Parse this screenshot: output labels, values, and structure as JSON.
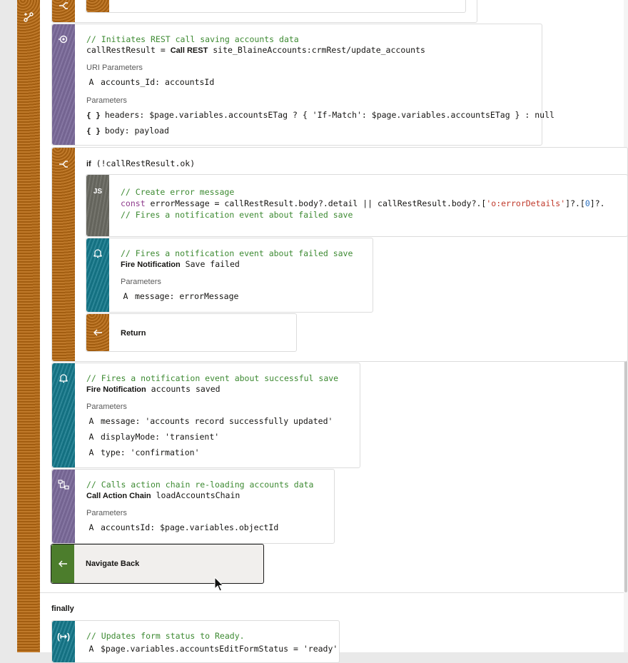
{
  "colors": {
    "sidebar_orange": "#b86a12",
    "rest_purple": "#7b6a9a",
    "notify_teal": "#15798c",
    "js_gray": "#6c6c64",
    "navigate_green": "#4c7d2c",
    "comment_green": "#3d8a32"
  },
  "icons": {
    "left_rail": "flow-diagram-icon",
    "top_if": "branch-icon",
    "rest": "rest-call-icon",
    "if": "branch-icon",
    "js": "JS",
    "notify": "bell-icon",
    "return": "return-arrow-icon",
    "call_chain": "action-chain-icon",
    "navigate": "navigate-back-icon",
    "assign": "assign-variables-icon"
  },
  "rest_call": {
    "comment": "// Initiates REST call saving accounts data",
    "result_var": "callRestResult =",
    "keyword": "Call REST",
    "endpoint": "site_BlaineAccounts:crmRest/update_accounts",
    "uri_params_label": "URI Parameters",
    "uri_param_name": "accounts_Id:",
    "uri_param_value": "accountsId",
    "params_label": "Parameters",
    "param1_braces": "{ }",
    "param1_name": "headers:",
    "param1_value": "$page.variables.accountsETag ? { 'If-Match': $page.variables.accountsETag } : null",
    "param2_braces": "{ }",
    "param2_name": "body:",
    "param2_value": "payload"
  },
  "if_block": {
    "keyword": "if",
    "condition": "(!callRestResult.ok)",
    "js": {
      "badge": "JS",
      "line1": "// Create error message",
      "line2_kw": "const",
      "line2_a": " errorMessage = callRestResult.body?.detail || callRestResult.body?.[",
      "line2_str": "'o:errorDetails'",
      "line2_b": "]?.[",
      "line2_num": "0",
      "line2_c": "]?.",
      "line3": "// Fires a notification event about failed save"
    },
    "notify": {
      "comment": "// Fires a notification event about failed save",
      "keyword": "Fire Notification",
      "summary": "Save failed",
      "params_label": "Parameters",
      "param_name": "message:",
      "param_value": "errorMessage"
    },
    "return_label": "Return"
  },
  "notify_success": {
    "comment": "// Fires a notification event about successful save",
    "keyword": "Fire Notification",
    "summary": "accounts saved",
    "params_label": "Parameters",
    "p1_name": "message:",
    "p1_value": "'accounts record successfully updated'",
    "p2_name": "displayMode:",
    "p2_value": "'transient'",
    "p3_name": "type:",
    "p3_value": "'confirmation'"
  },
  "call_chain": {
    "comment": "// Calls action chain re-loading accounts data",
    "keyword": "Call Action Chain",
    "summary": "loadAccountsChain",
    "params_label": "Parameters",
    "param_name": "accountsId:",
    "param_value": "$page.variables.objectId"
  },
  "navigate_back": {
    "label": "Navigate Back"
  },
  "finally": {
    "label": "finally",
    "comment": "// Updates form status to Ready.",
    "assign_line": "$page.variables.accountsEditFormStatus = 'ready'"
  },
  "param_marker": "A"
}
